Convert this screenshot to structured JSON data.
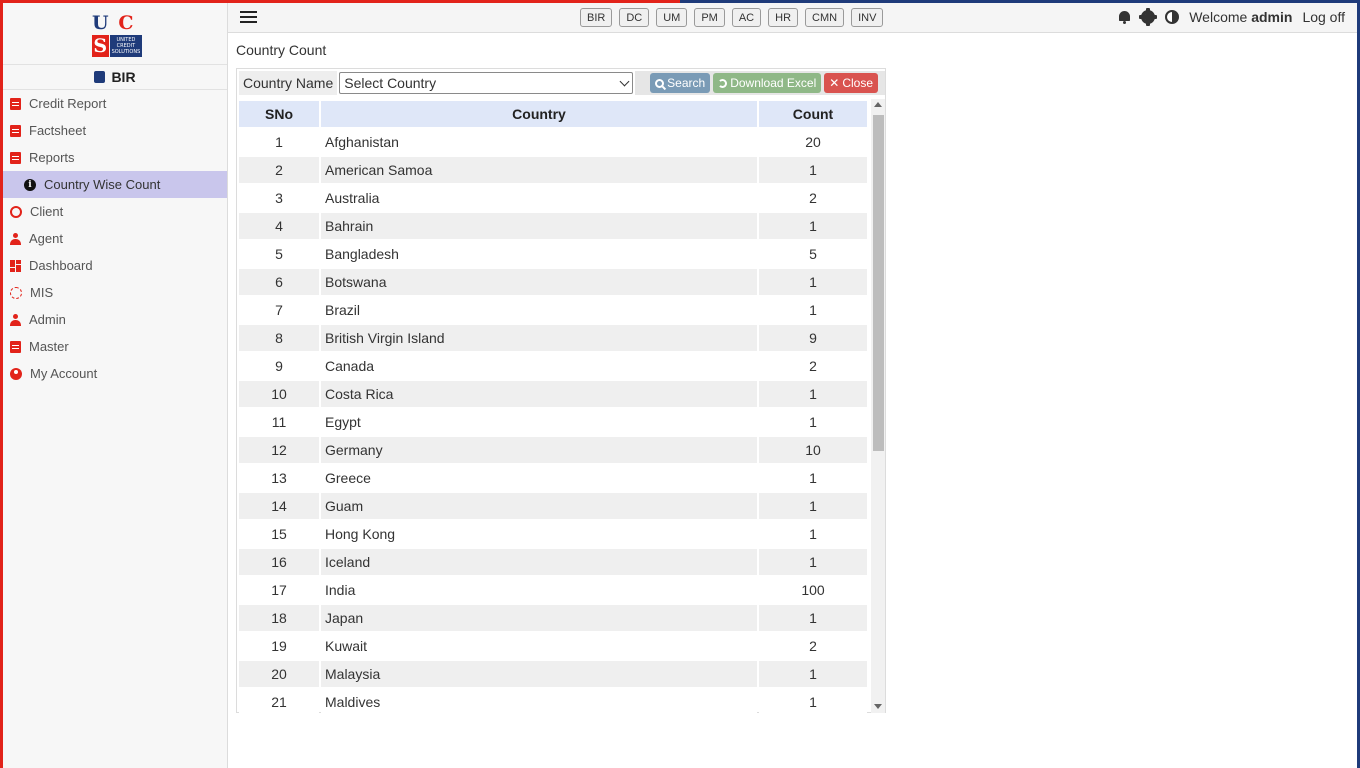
{
  "logo": {
    "letters": [
      "U",
      "C",
      "S"
    ],
    "tagline": "UNITED CREDIT SOLUTIONS"
  },
  "sidebar": {
    "module": "BIR",
    "items": [
      {
        "label": "Credit Report",
        "icon": "credit-report-icon"
      },
      {
        "label": "Factsheet",
        "icon": "factsheet-icon"
      },
      {
        "label": "Reports",
        "icon": "reports-icon"
      },
      {
        "label": "Country Wise Count",
        "icon": "info-icon"
      },
      {
        "label": "Client",
        "icon": "client-icon"
      },
      {
        "label": "Agent",
        "icon": "agent-icon"
      },
      {
        "label": "Dashboard",
        "icon": "dashboard-icon"
      },
      {
        "label": "MIS",
        "icon": "mis-icon"
      },
      {
        "label": "Admin",
        "icon": "admin-icon"
      },
      {
        "label": "Master",
        "icon": "master-icon"
      },
      {
        "label": "My Account",
        "icon": "my-account-icon"
      }
    ]
  },
  "topbar": {
    "modules": [
      "BIR",
      "DC",
      "UM",
      "PM",
      "AC",
      "HR",
      "CMN",
      "INV"
    ],
    "welcome": "Welcome",
    "user": "admin",
    "logoff": "Log off"
  },
  "page": {
    "title": "Country Count",
    "filter_label": "Country Name",
    "select_value": "Select Country",
    "search_label": "Search",
    "excel_label": "Download Excel",
    "close_label": "Close"
  },
  "table": {
    "headers": [
      "SNo",
      "Country",
      "Count"
    ],
    "rows": [
      [
        "1",
        "Afghanistan",
        "20"
      ],
      [
        "2",
        "American Samoa",
        "1"
      ],
      [
        "3",
        "Australia",
        "2"
      ],
      [
        "4",
        "Bahrain",
        "1"
      ],
      [
        "5",
        "Bangladesh",
        "5"
      ],
      [
        "6",
        "Botswana",
        "1"
      ],
      [
        "7",
        "Brazil",
        "1"
      ],
      [
        "8",
        "British Virgin Island",
        "9"
      ],
      [
        "9",
        "Canada",
        "2"
      ],
      [
        "10",
        "Costa Rica",
        "1"
      ],
      [
        "11",
        "Egypt",
        "1"
      ],
      [
        "12",
        "Germany",
        "10"
      ],
      [
        "13",
        "Greece",
        "1"
      ],
      [
        "14",
        "Guam",
        "1"
      ],
      [
        "15",
        "Hong Kong",
        "1"
      ],
      [
        "16",
        "Iceland",
        "1"
      ],
      [
        "17",
        "India",
        "100"
      ],
      [
        "18",
        "Japan",
        "1"
      ],
      [
        "19",
        "Kuwait",
        "2"
      ],
      [
        "20",
        "Malaysia",
        "1"
      ],
      [
        "21",
        "Maldives",
        "1"
      ]
    ]
  },
  "colors": {
    "brand_red": "#e2231a",
    "brand_blue": "#1f3b7a",
    "active_nav": "#c9c6ec",
    "header_bg": "#dfe7f8"
  }
}
